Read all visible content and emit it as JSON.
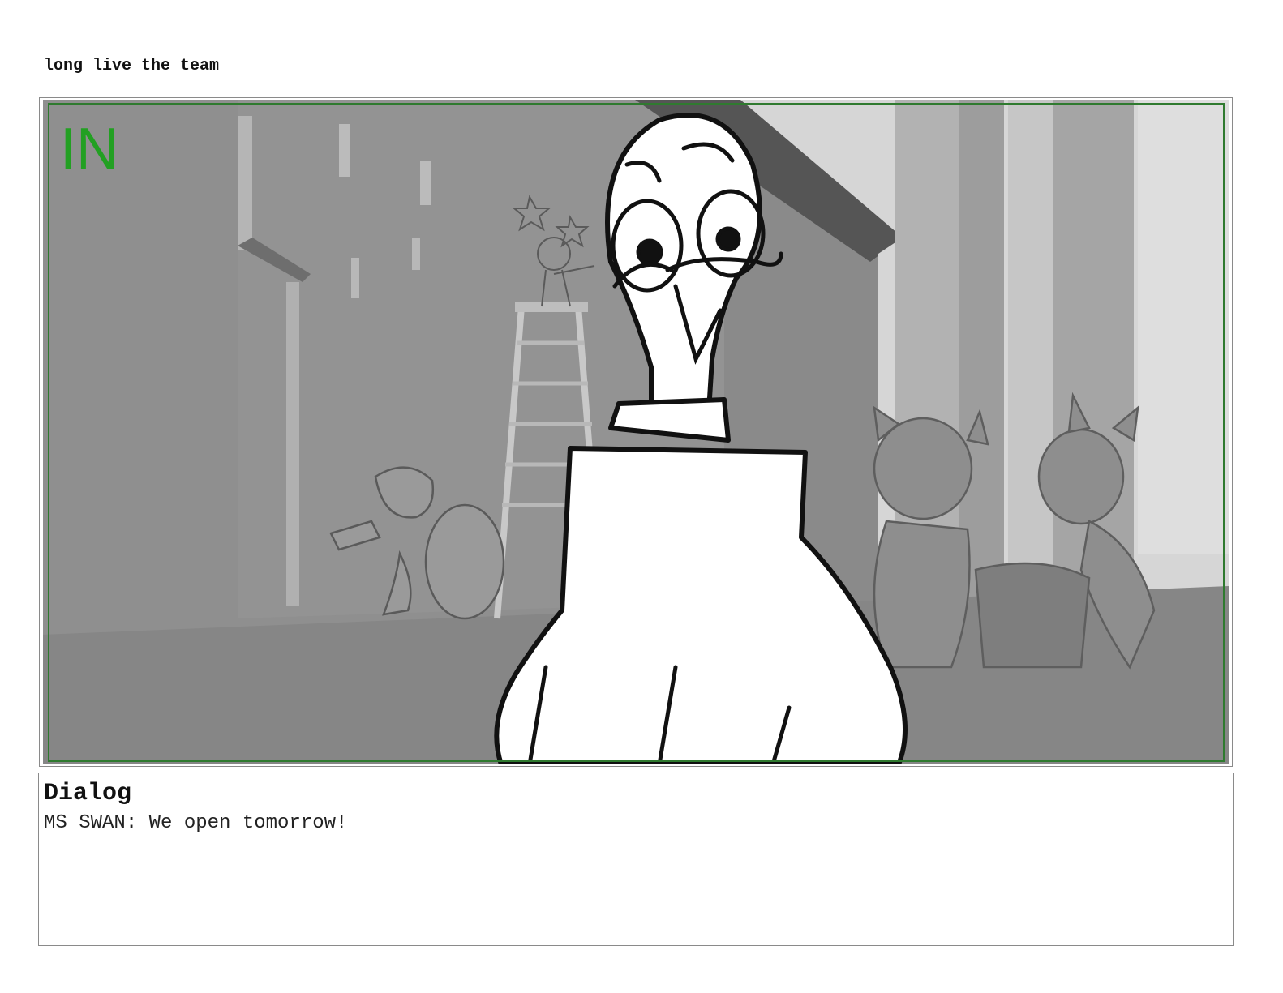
{
  "page": {
    "title": "long live the team"
  },
  "panel": {
    "transition_label": "IN",
    "frame_color": "#2f7a2f",
    "label_color": "#22a022"
  },
  "dialog": {
    "heading": "Dialog",
    "text": "MS SWAN: We open tomorrow!"
  }
}
